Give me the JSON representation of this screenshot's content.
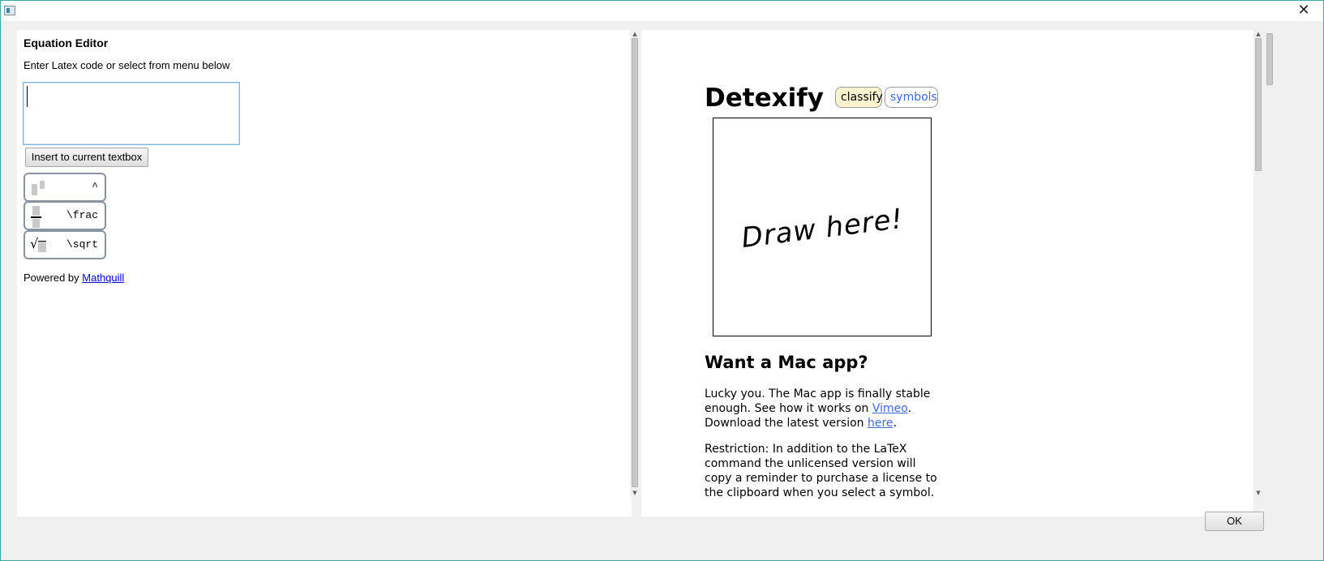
{
  "window": {
    "close_glyph": "✕"
  },
  "left": {
    "title": "Equation Editor",
    "instruction": "Enter Latex code or select from menu below",
    "latex_input": {
      "value": "",
      "placeholder": ""
    },
    "insert_button": "Insert to current textbox",
    "symbols": [
      {
        "code": "^",
        "icon": "superscript-icon"
      },
      {
        "code": "\\frac",
        "icon": "fraction-icon"
      },
      {
        "code": "\\sqrt",
        "icon": "square-root-icon"
      }
    ],
    "powered_by": "Powered by",
    "powered_link": "Mathquill"
  },
  "right": {
    "title": "Detexify",
    "tabs": {
      "classify": "classify",
      "symbols": "symbols"
    },
    "canvas_hint": "Draw here!",
    "mac_heading": "Want a Mac app?",
    "para1": {
      "a": "Lucky you. The Mac app is finally stable enough. See how it works on ",
      "link1": "Vimeo",
      "b": ". Download the latest version ",
      "link2": "here",
      "c": "."
    },
    "para2": "Restriction: In addition to the LaTeX command the unlicensed version will copy a reminder to purchase a license to the clipboard when you select a symbol."
  },
  "footer": {
    "ok_button": "OK"
  },
  "scrollbars": {
    "up_arrow": "▲",
    "down_arrow": "▼"
  },
  "colors": {
    "accent_border": "#3aa8a8",
    "link": "#3c6cd6",
    "classify_tab_bg": "#fdf3cf"
  }
}
